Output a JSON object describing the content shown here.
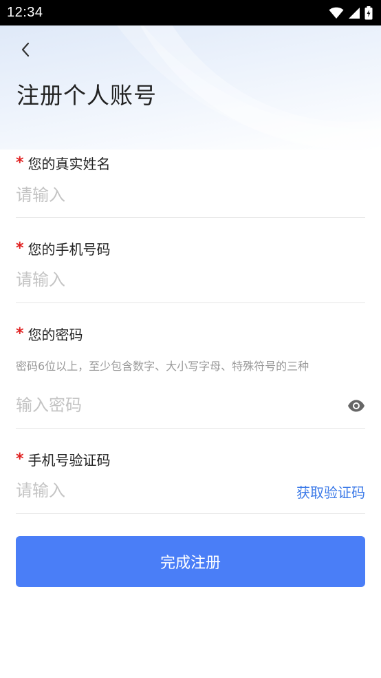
{
  "status_bar": {
    "time": "12:34"
  },
  "header": {
    "title": "注册个人账号"
  },
  "form": {
    "name": {
      "required_mark": "*",
      "label": "您的真实姓名",
      "placeholder": "请输入",
      "value": ""
    },
    "phone": {
      "required_mark": "*",
      "label": "您的手机号码",
      "placeholder": "请输入",
      "value": ""
    },
    "password": {
      "required_mark": "*",
      "label": "您的密码",
      "hint": "密码6位以上，至少包含数字、大小写字母、特殊符号的三种",
      "placeholder": "输入密码",
      "value": ""
    },
    "sms_code": {
      "required_mark": "*",
      "label": "手机号验证码",
      "placeholder": "请输入",
      "value": "",
      "get_code_label": "获取验证码"
    }
  },
  "submit": {
    "label": "完成注册"
  },
  "colors": {
    "accent": "#4a7ef7",
    "link": "#3c7ae8",
    "required": "#e02020"
  }
}
